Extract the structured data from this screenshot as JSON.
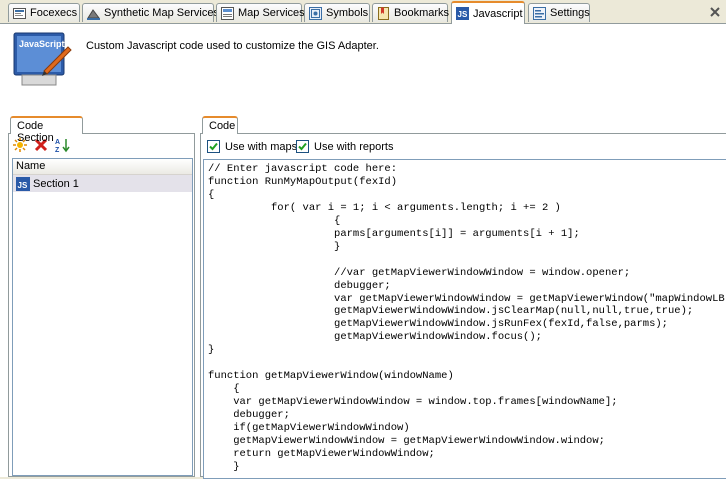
{
  "tabs": [
    {
      "label": "Focexecs",
      "icon": "focexec-icon",
      "active": false
    },
    {
      "label": "Synthetic Map Services",
      "icon": "synthetic-map-icon",
      "active": false
    },
    {
      "label": "Map Services",
      "icon": "map-services-icon",
      "active": false
    },
    {
      "label": "Symbols",
      "icon": "symbols-icon",
      "active": false
    },
    {
      "label": "Bookmarks",
      "icon": "bookmarks-icon",
      "active": false
    },
    {
      "label": "Javascript",
      "icon": "javascript-icon",
      "active": true
    },
    {
      "label": "Settings",
      "icon": "settings-icon",
      "active": false
    }
  ],
  "header": {
    "badge_text": "JavaScript",
    "description": "Custom Javascript code used to customize the GIS Adapter."
  },
  "left_panel": {
    "tab_label": "Code Section",
    "toolbar": [
      "new-icon",
      "delete-icon",
      "sort-icon"
    ],
    "column_header": "Name",
    "items": [
      {
        "label": "Section 1",
        "icon": "javascript-file-icon"
      }
    ]
  },
  "right_panel": {
    "tab_label": "Code",
    "use_with_maps_label": "Use with maps",
    "use_with_maps_checked": true,
    "use_with_reports_label": "Use with reports",
    "use_with_reports_checked": true,
    "code": "// Enter javascript code here:\nfunction RunMyMapOutput(fexId)\n{\n          for( var i = 1; i < arguments.length; i += 2 )\n                    {\n                    parms[arguments[i]] = arguments[i + 1];\n                    }\n\n                    //var getMapViewerWindowWindow = window.opener;\n                    debugger;\n                    var getMapViewerWindowWindow = getMapViewerWindow(\"mapWindowLB\n                    getMapViewerWindowWindow.jsClearMap(null,null,true,true);\n                    getMapViewerWindowWindow.jsRunFex(fexId,false,parms);\n                    getMapViewerWindowWindow.focus();\n}\n\nfunction getMapViewerWindow(windowName)\n    {\n    var getMapViewerWindowWindow = window.top.frames[windowName];\n    debugger;\n    if(getMapViewerWindowWindow)\n    getMapViewerWindowWindow = getMapViewerWindowWindow.window;\n    return getMapViewerWindowWindow;\n    }"
  },
  "colors": {
    "active_tab_accent": "#e68b2c",
    "selected_row": "#e4e2ea",
    "border": "#919b9c"
  }
}
